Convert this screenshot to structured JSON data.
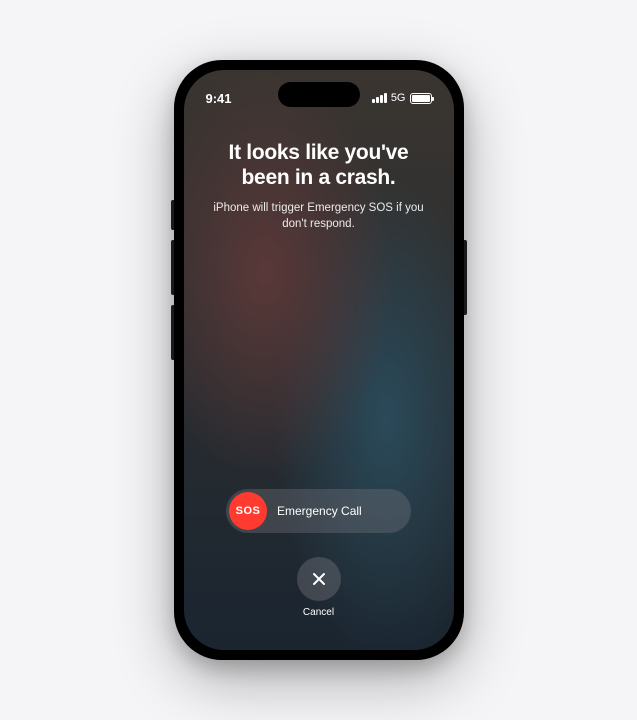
{
  "statusBar": {
    "time": "9:41",
    "network": "5G"
  },
  "headline": "It looks like you've been in a crash.",
  "subtext": "iPhone will trigger Emergency SOS if you don't respond.",
  "sosSlider": {
    "thumbLabel": "SOS",
    "trackLabel": "Emergency Call"
  },
  "cancel": {
    "label": "Cancel"
  }
}
